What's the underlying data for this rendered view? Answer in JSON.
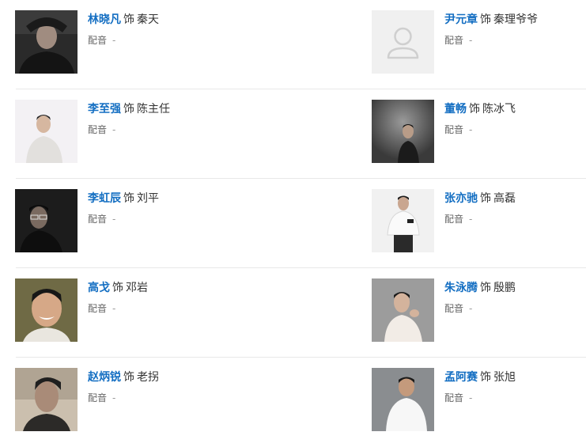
{
  "labels": {
    "as": "饰",
    "dub": "配音",
    "dub_empty": "-"
  },
  "cast": [
    {
      "actor": "林晓凡",
      "role": "秦天",
      "photo": "dark-portrait"
    },
    {
      "actor": "尹元章",
      "role": "秦理爷爷",
      "photo": "placeholder"
    },
    {
      "actor": "李至强",
      "role": "陈主任",
      "photo": "light-portrait"
    },
    {
      "actor": "董畅",
      "role": "陈冰飞",
      "photo": "dark-portrait"
    },
    {
      "actor": "李虹辰",
      "role": "刘平",
      "photo": "dark-portrait"
    },
    {
      "actor": "张亦驰",
      "role": "高磊",
      "photo": "light-portrait"
    },
    {
      "actor": "高戈",
      "role": "邓岩",
      "photo": "olive-portrait"
    },
    {
      "actor": "朱泳腾",
      "role": "殷鹏",
      "photo": "grey-portrait"
    },
    {
      "actor": "赵炳锐",
      "role": "老拐",
      "photo": "beige-portrait"
    },
    {
      "actor": "孟阿赛",
      "role": "张旭",
      "photo": "grey-portrait"
    }
  ]
}
